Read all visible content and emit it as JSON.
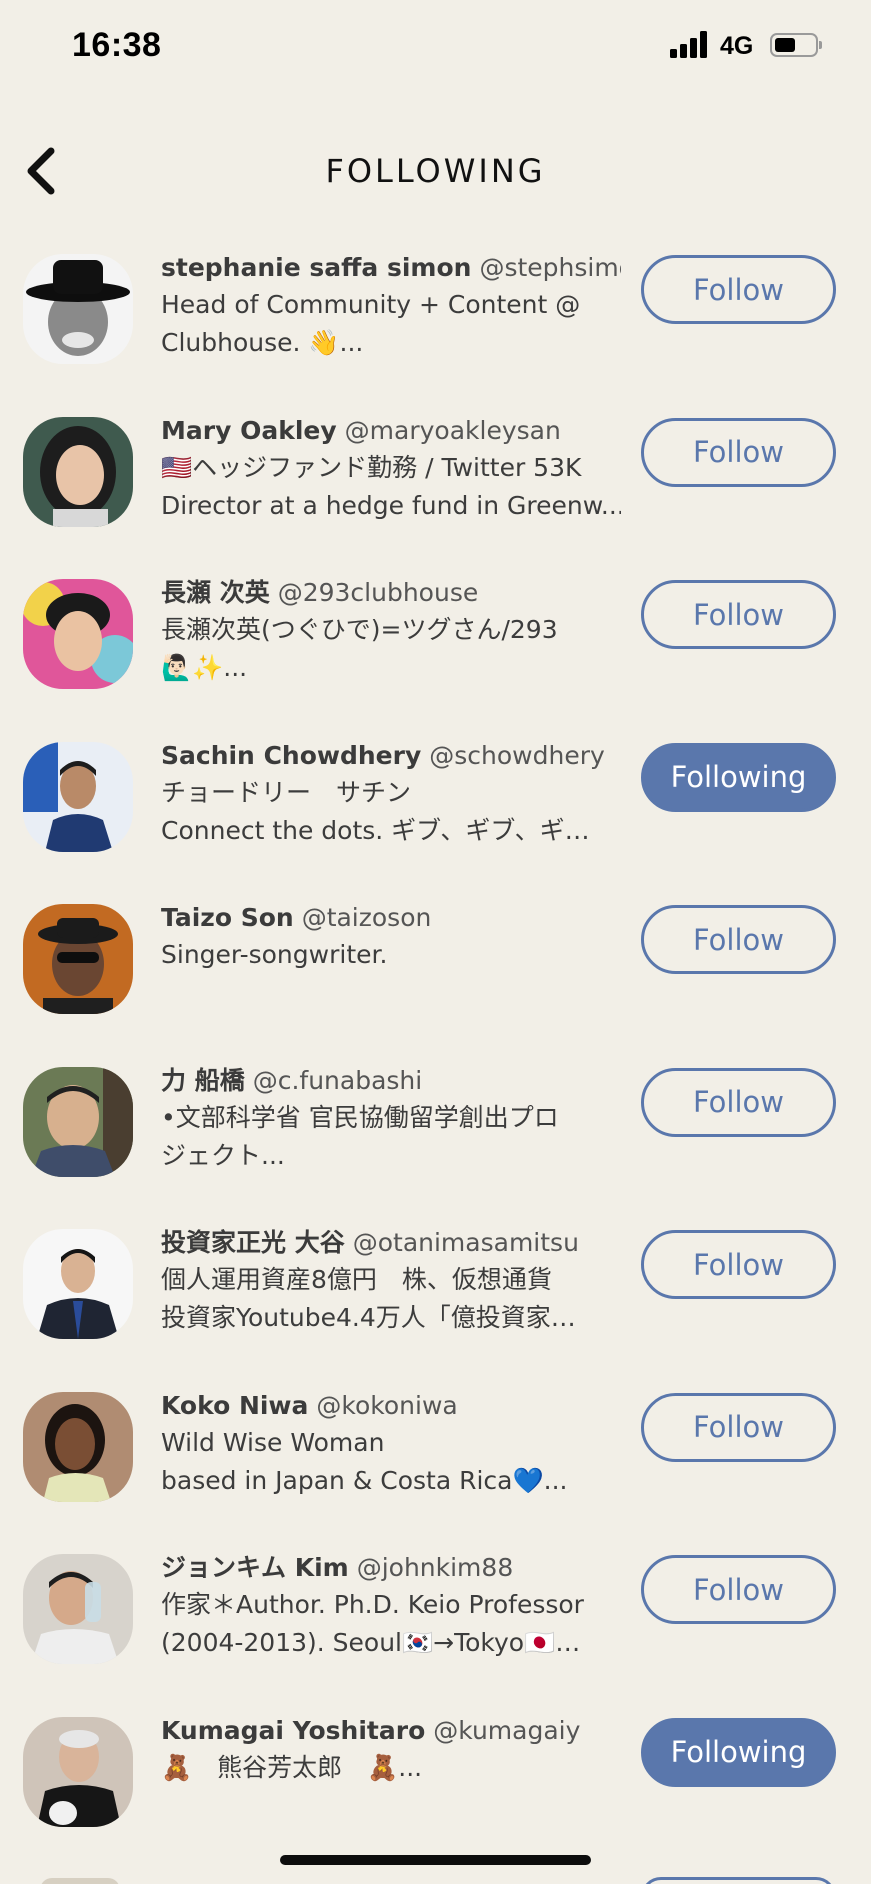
{
  "status_bar": {
    "time": "16:38",
    "network": "4G",
    "battery_level": 0.5
  },
  "header": {
    "title": "FOLLOWING",
    "back_icon": "chevron-left-icon"
  },
  "colors": {
    "background": "#f2efe7",
    "accent": "#5a77ac"
  },
  "users": [
    {
      "name": "stephanie saffa simon",
      "handle": "@stephsimon",
      "bio1": "Head of Community + Content @",
      "bio2": "Clubhouse. 👋...",
      "button": "Follow",
      "following": false
    },
    {
      "name": "Mary Oakley",
      "handle": "@maryoakleysan",
      "bio1": "🇺🇸ヘッジファンド勤務 / Twitter 53K",
      "bio2": "Director at a hedge fund in Greenw...",
      "button": "Follow",
      "following": false
    },
    {
      "name": "長瀬 次英",
      "handle": "@293clubhouse",
      "bio1": "長瀬次英(つぐひで)=ツグさん/293",
      "bio2": "🙋🏻‍♂️✨...",
      "button": "Follow",
      "following": false
    },
    {
      "name": "Sachin Chowdhery",
      "handle": "@schowdhery",
      "bio1": "チョードリー　サチン",
      "bio2": "Connect the dots. ギブ、ギブ、ギ…",
      "button": "Following",
      "following": true
    },
    {
      "name": "Taizo Son",
      "handle": "@taizoson",
      "bio1": "Singer-songwriter.",
      "bio2": "",
      "button": "Follow",
      "following": false
    },
    {
      "name": "力 船橋",
      "handle": "@c.funabashi",
      "bio1": "•文部科学省 官民協働留学創出プロ",
      "bio2": "ジェクト...",
      "button": "Follow",
      "following": false
    },
    {
      "name": "投資家正光 大谷",
      "handle": "@otanimasamitsu",
      "bio1": "個人運用資産8億円　株、仮想通貨",
      "bio2": "投資家Youtube4.4万人「億投資家…",
      "button": "Follow",
      "following": false
    },
    {
      "name": "Koko Niwa",
      "handle": "@kokoniwa",
      "bio1": "Wild Wise Woman",
      "bio2": "based in Japan & Costa Rica💙...",
      "button": "Follow",
      "following": false
    },
    {
      "name": "ジョンキム Kim",
      "handle": "@johnkim88",
      "bio1": "作家＊Author. Ph.D. Keio Professor",
      "bio2": "(2004-2013). Seoul🇰🇷→Tokyo🇯🇵…",
      "button": "Follow",
      "following": false
    },
    {
      "name": "Kumagai Yoshitaro",
      "handle": "@kumagaiy",
      "bio1": "🧸　熊谷芳太郎　🧸...",
      "bio2": "",
      "button": "Following",
      "following": true
    }
  ]
}
